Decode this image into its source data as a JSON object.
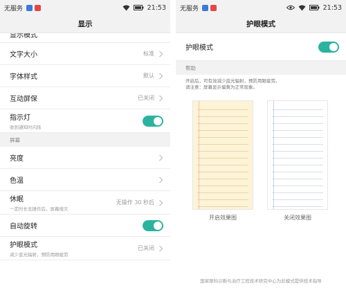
{
  "status_bar": {
    "carrier": "无服务",
    "time": "21:53"
  },
  "left": {
    "title": "显示",
    "partial_item": {
      "label": "显示模式"
    },
    "items_top": [
      {
        "label": "文字大小",
        "value": "标准"
      },
      {
        "label": "字体样式",
        "value": "默认"
      },
      {
        "label": "互动屏保",
        "value": "已关闭"
      }
    ],
    "indicator": {
      "label": "指示灯",
      "sub": "收到通知时闪烁"
    },
    "section_label": "屏幕",
    "items_screen": [
      {
        "label": "亮度"
      },
      {
        "label": "色温"
      }
    ],
    "sleep": {
      "label": "休眠",
      "sub": "一定时长无操作后，屏幕熄灭",
      "value": "无操作 30 秒后"
    },
    "auto_rotate": {
      "label": "自动旋转"
    },
    "eye_mode": {
      "label": "护眼模式",
      "sub": "减少蓝光辐射，预防用眼疲劳",
      "value": "已关闭"
    }
  },
  "right": {
    "title": "护眼模式",
    "toggle_label": "护眼模式",
    "help_header": "帮助",
    "help_lines": [
      "开启后，可有效减少蓝光辐射，预防用眼疲劳。",
      "请注意：屏幕显示偏黄为正常现象。"
    ],
    "caption_on": "开启效果图",
    "caption_off": "关闭效果图",
    "footer": "国家眼科诊断与治疗工程技术研究中心为此模式提供技术指导"
  },
  "colors": {
    "accent": "#2bb3a0",
    "warm_paper": "#fdf3d6",
    "section_bg": "#f2f2f2"
  }
}
